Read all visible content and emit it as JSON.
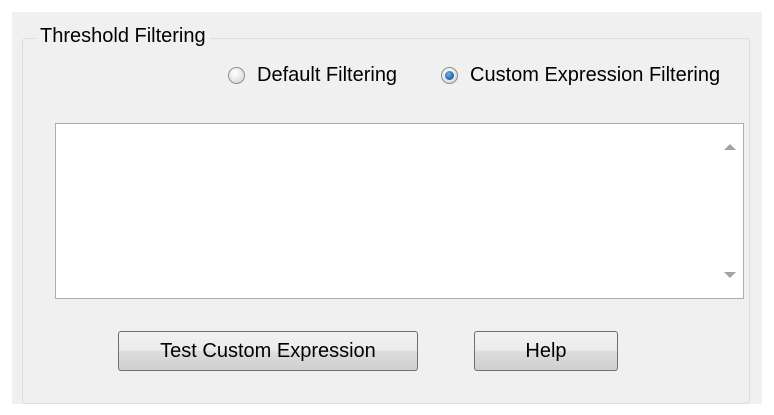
{
  "group": {
    "title": "Threshold Filtering"
  },
  "filter_mode": {
    "options": [
      {
        "label": "Default Filtering",
        "selected": false
      },
      {
        "label": "Custom Expression Filtering",
        "selected": true
      }
    ]
  },
  "expression": {
    "value": ""
  },
  "buttons": {
    "test_label": "Test Custom Expression",
    "help_label": "Help"
  }
}
